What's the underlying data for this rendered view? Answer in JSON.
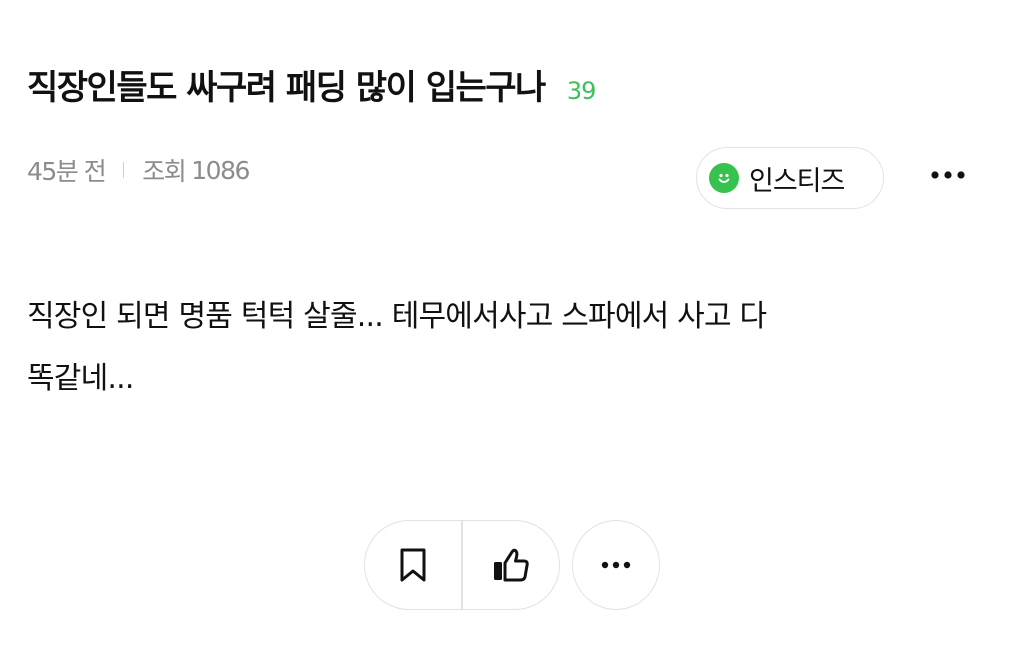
{
  "post": {
    "title": "직장인들도 싸구려 패딩 많이 입는구나",
    "comment_count": "39",
    "time_ago": "45분 전",
    "views_label": "조회",
    "views_count": "1086",
    "body_line1": "직장인 되면 명품 턱턱 살줄... 테무에서사고 스파에서 사고 다",
    "body_line2": "똑같네..."
  },
  "channel": {
    "name": "인스티즈",
    "icon": "smile-icon",
    "color": "#37c24d"
  },
  "actions": {
    "bookmark_icon": "bookmark-icon",
    "like_icon": "thumbs-up-icon",
    "more_icon": "more-horizontal-icon"
  },
  "colors": {
    "accent": "#3cc15a",
    "meta_text": "#8c8c8c",
    "border": "#e2e2e2"
  }
}
